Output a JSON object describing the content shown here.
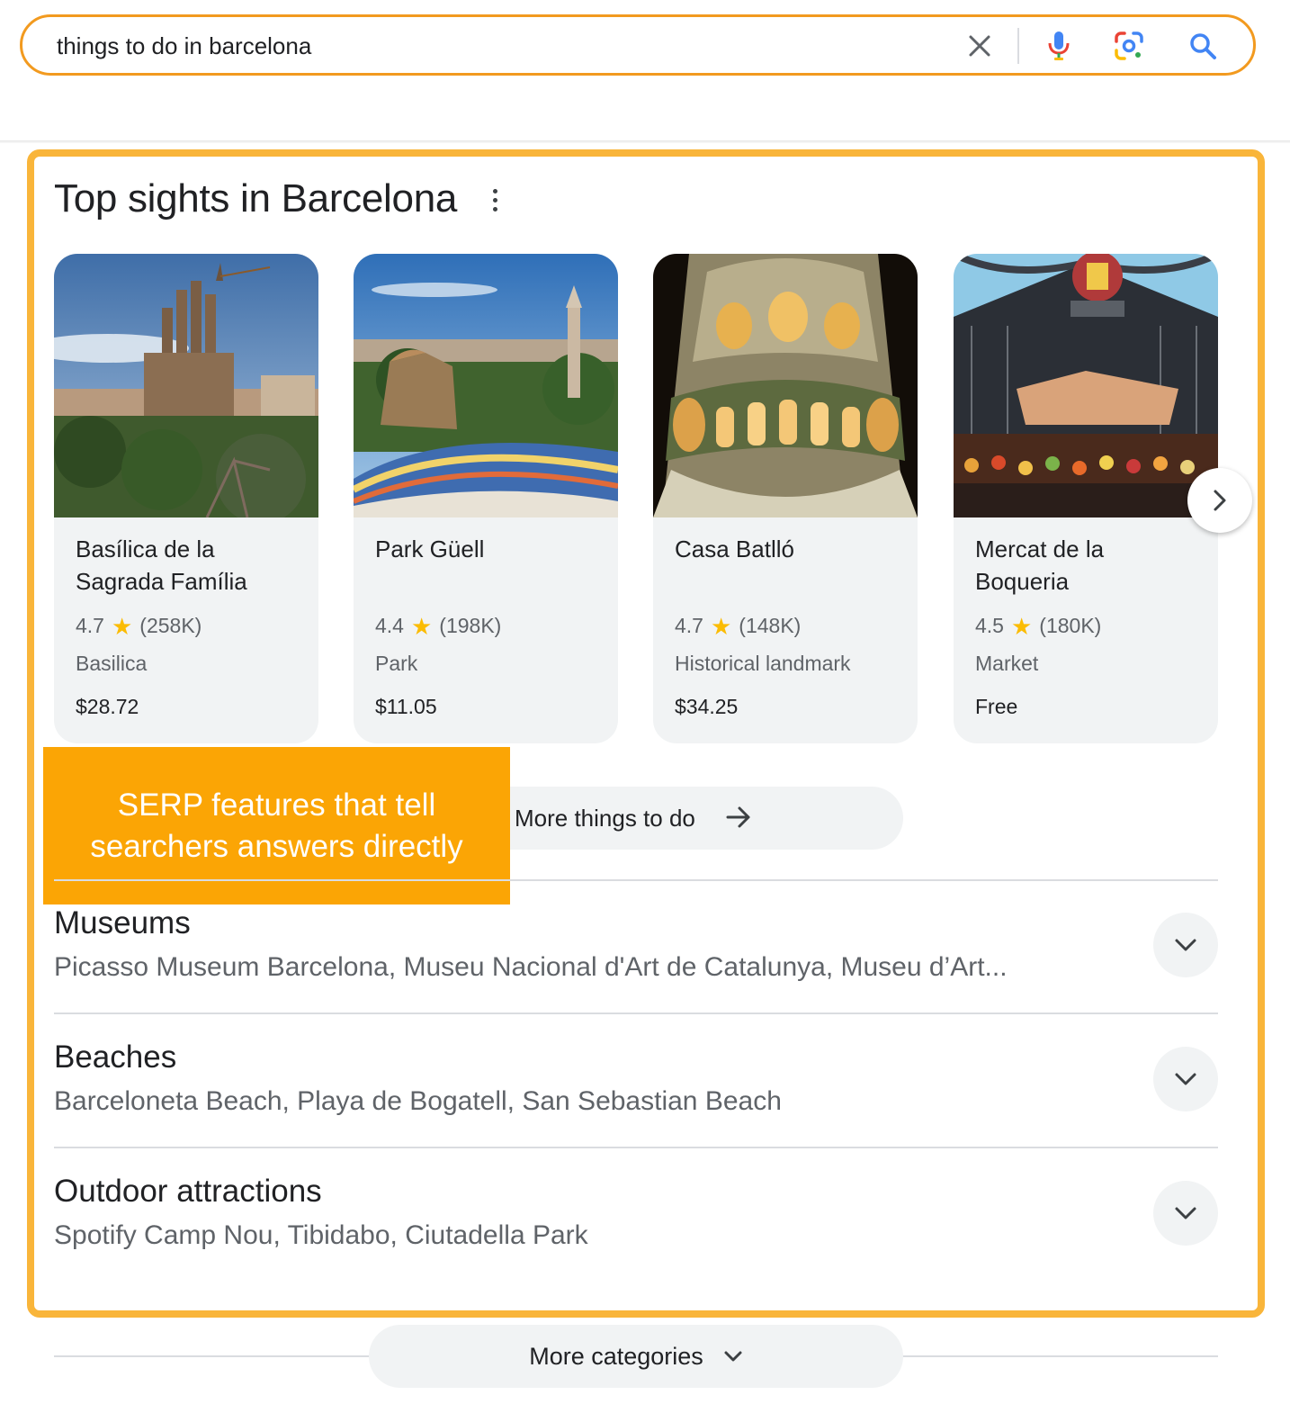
{
  "search": {
    "query": "things to do in barcelona",
    "icons": [
      "close-icon",
      "microphone-icon",
      "google-lens-icon",
      "search-icon"
    ]
  },
  "top_sights": {
    "title": "Top sights in Barcelona",
    "cards": [
      {
        "name": "Basílica de la Sagrada Família",
        "rating": "4.7",
        "reviews": "(258K)",
        "type": "Basilica",
        "price": "$28.72"
      },
      {
        "name": "Park Güell",
        "rating": "4.4",
        "reviews": "(198K)",
        "type": "Park",
        "price": "$11.05"
      },
      {
        "name": "Casa Batlló",
        "rating": "4.7",
        "reviews": "(148K)",
        "type": "Historical landmark",
        "price": "$34.25"
      },
      {
        "name": "Mercat de la Boqueria",
        "rating": "4.5",
        "reviews": "(180K)",
        "type": "Market",
        "price": "Free"
      }
    ],
    "star": "★",
    "more_label": "More things to do"
  },
  "callout": {
    "line1": "SERP features that tell",
    "line2": "searchers answers directly"
  },
  "categories": [
    {
      "title": "Museums",
      "items": "Picasso Museum Barcelona, Museu Nacional d'Art de Catalunya, Museu d’Art..."
    },
    {
      "title": "Beaches",
      "items": "Barceloneta Beach, Playa de Bogatell, San Sebastian Beach"
    },
    {
      "title": "Outdoor attractions",
      "items": "Spotify Camp Nou, Tibidabo, Ciutadella Park"
    }
  ],
  "more_categories_label": "More categories",
  "colors": {
    "search_border": "#f29a1f",
    "highlight_frame": "#f9b53a",
    "callout_bg": "#fba505",
    "star": "#fbbc04"
  }
}
